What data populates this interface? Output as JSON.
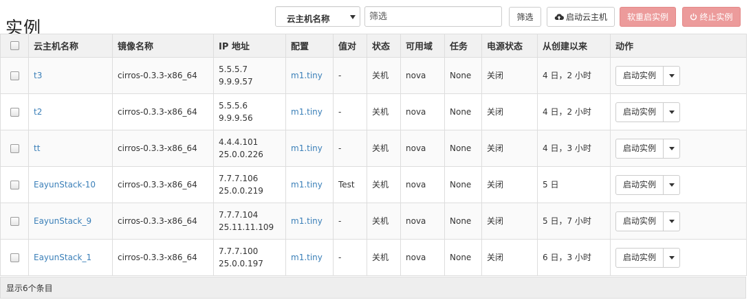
{
  "page": {
    "title": "实例"
  },
  "toolbar": {
    "filter_field_selected": "云主机名称",
    "filter_placeholder": "筛选",
    "filter_button": "筛选",
    "launch_button": "启动云主机",
    "soft_reboot_button": "软重启实例",
    "terminate_button": "终止实例"
  },
  "colors": {
    "danger_button": "#ec9b9b",
    "link": "#3a7fb8",
    "header_bg": "#f1f1f1"
  },
  "table": {
    "headers": [
      "云主机名称",
      "镜像名称",
      "IP 地址",
      "配置",
      "值对",
      "状态",
      "可用域",
      "任务",
      "电源状态",
      "从创建以来",
      "动作"
    ],
    "rows": [
      {
        "name": "t3",
        "image": "cirros-0.3.3-x86_64",
        "ip1": "5.5.5.7",
        "ip2": "9.9.9.57",
        "flavor": "m1.tiny",
        "keypair": "-",
        "status": "关机",
        "az": "nova",
        "task": "None",
        "power": "关闭",
        "age": "4 日，2 小时",
        "action": "启动实例"
      },
      {
        "name": "t2",
        "image": "cirros-0.3.3-x86_64",
        "ip1": "5.5.5.6",
        "ip2": "9.9.9.56",
        "flavor": "m1.tiny",
        "keypair": "-",
        "status": "关机",
        "az": "nova",
        "task": "None",
        "power": "关闭",
        "age": "4 日，2 小时",
        "action": "启动实例"
      },
      {
        "name": "tt",
        "image": "cirros-0.3.3-x86_64",
        "ip1": "4.4.4.101",
        "ip2": "25.0.0.226",
        "flavor": "m1.tiny",
        "keypair": "-",
        "status": "关机",
        "az": "nova",
        "task": "None",
        "power": "关闭",
        "age": "4 日，3 小时",
        "action": "启动实例"
      },
      {
        "name": "EayunStack-10",
        "image": "cirros-0.3.3-x86_64",
        "ip1": "7.7.7.106",
        "ip2": "25.0.0.219",
        "flavor": "m1.tiny",
        "keypair": "Test",
        "status": "关机",
        "az": "nova",
        "task": "None",
        "power": "关闭",
        "age": "5 日",
        "action": "启动实例"
      },
      {
        "name": "EayunStack_9",
        "image": "cirros-0.3.3-x86_64",
        "ip1": "7.7.7.104",
        "ip2": "25.11.11.109",
        "flavor": "m1.tiny",
        "keypair": "-",
        "status": "关机",
        "az": "nova",
        "task": "None",
        "power": "关闭",
        "age": "5 日，7 小时",
        "action": "启动实例"
      },
      {
        "name": "EayunStack_1",
        "image": "cirros-0.3.3-x86_64",
        "ip1": "7.7.7.100",
        "ip2": "25.0.0.197",
        "flavor": "m1.tiny",
        "keypair": "-",
        "status": "关机",
        "az": "nova",
        "task": "None",
        "power": "关闭",
        "age": "6 日，3 小时",
        "action": "启动实例"
      }
    ],
    "footer": "显示6个条目"
  }
}
